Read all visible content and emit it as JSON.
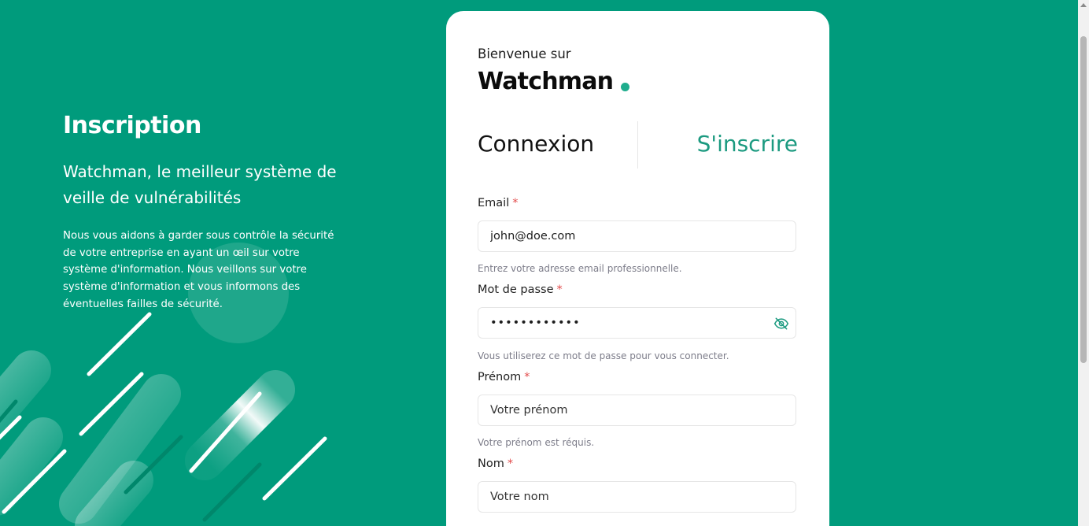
{
  "left": {
    "title": "Inscription",
    "subtitle": "Watchman, le meilleur système de veille de vulnérabilités",
    "description": "Nous vous aidons à garder sous contrôle la sécurité de votre entreprise en ayant un œil sur votre système d'information. Nous veillons sur votre système d'information et vous informons des éventuelles failles de sécurité."
  },
  "card": {
    "welcome": "Bienvenue sur",
    "brand": "Watchman",
    "tabs": {
      "login": "Connexion",
      "signup": "S'inscrire"
    }
  },
  "form": {
    "email": {
      "label": "Email",
      "required": "*",
      "value": "john@doe.com",
      "hint": "Entrez votre adresse email professionnelle."
    },
    "password": {
      "label": "Mot de passe",
      "required": "*",
      "value": "••••••••••••",
      "hint": "Vous utiliserez ce mot de passe pour vous connecter."
    },
    "firstname": {
      "label": "Prénom",
      "required": "*",
      "placeholder": "Votre prénom",
      "hint": "Votre prénom est réquis."
    },
    "lastname": {
      "label": "Nom",
      "required": "*",
      "placeholder": "Votre nom"
    }
  },
  "colors": {
    "background": "#009b7c",
    "accent": "#1c9a80",
    "required": "#e24b4b"
  },
  "icons": {
    "password_toggle": "eye-off-icon"
  }
}
